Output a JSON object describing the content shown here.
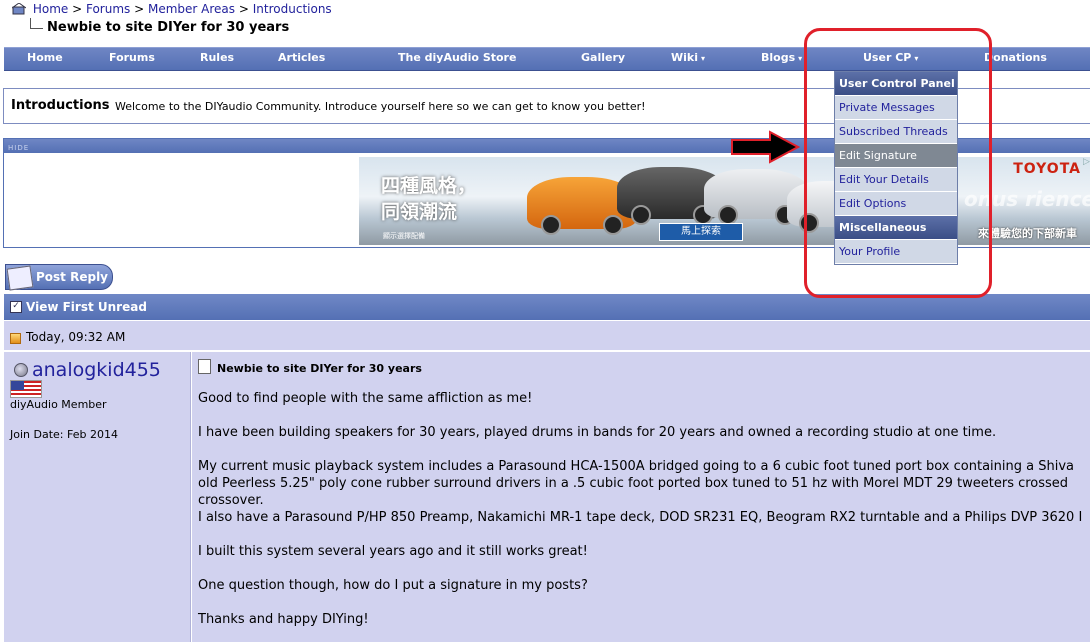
{
  "breadcrumb": {
    "home": "Home",
    "forums": "Forums",
    "member_areas": "Member Areas",
    "introductions": "Introductions",
    "separator": ">"
  },
  "thread_title": "Newbie to site DIYer for 30 years",
  "navbar": {
    "items": [
      "Home",
      "Forums",
      "Rules",
      "Articles",
      "The diyAudio Store",
      "Gallery",
      "Wiki",
      "Blogs",
      "User CP",
      "Donations"
    ],
    "dropdown_arrow": "▾"
  },
  "forum": {
    "name": "Introductions",
    "description": "Welcome to the DIYaudio Community. Introduce yourself here so we can get to know you better!"
  },
  "ad": {
    "hide_label": "HIDE",
    "headline_1": "四種風格，",
    "headline_2": "同領潮流",
    "small_text": "顯示選擇配備",
    "button": "馬上探索",
    "brand": "TOYOTA",
    "tagline": "來體驗您的下部新車",
    "overlay_text": "onus rience"
  },
  "post_reply": "Post Reply",
  "view_first_unread": "View First Unread",
  "post": {
    "date": "Today, 09:32 AM",
    "username": "analogkid455",
    "user_title": "diyAudio Member",
    "join_date": "Join Date: Feb 2014",
    "title": "Newbie to site DIYer for 30 years",
    "lines": [
      "Good to find people with the same affliction as me!",
      "I have been building speakers for 30 years, played drums in bands for 20 years and owned a recording studio at one time.",
      "My current music playback system includes a Parasound HCA-1500A bridged going to a 6 cubic foot tuned port box containing a Shiva",
      "old Peerless 5.25\" poly cone rubber surround drivers in a .5 cubic foot ported box tuned to 51 hz with Morel MDT 29 tweeters crossed",
      "crossover.",
      "I also have a Parasound P/HP 850 Preamp, Nakamichi MR-1 tape deck, DOD SR231 EQ, Beogram RX2 turntable and a Philips DVP 3620 I",
      "I built this system several years ago and it still works great!",
      "One question though, how do I put a signature in my posts?",
      "Thanks and happy DIYing!"
    ]
  },
  "dropdown": {
    "header": "User Control Panel",
    "items": [
      "Private Messages",
      "Subscribed Threads",
      "Edit Signature",
      "Edit Your Details",
      "Edit Options"
    ],
    "section": "Miscellaneous",
    "misc_items": [
      "Your Profile"
    ],
    "active": "Edit Signature"
  },
  "colors": {
    "nav": "#5470b4",
    "post_bg": "#d1d2ef",
    "link": "#22229c",
    "highlight": "#e0202a"
  }
}
